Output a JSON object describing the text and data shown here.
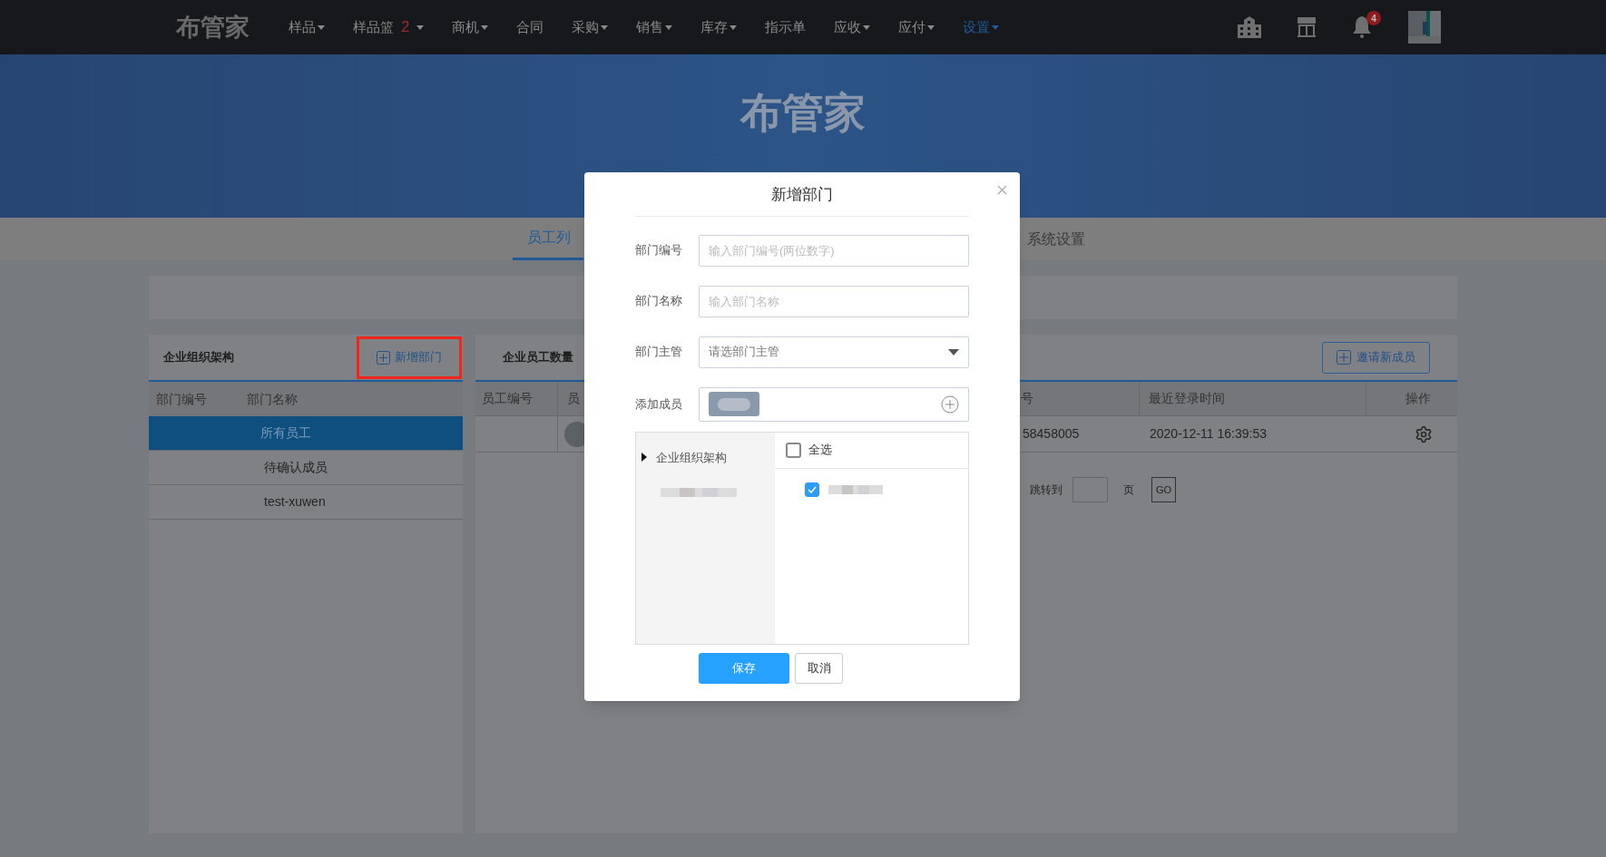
{
  "nav": {
    "logo": "布管家",
    "items": [
      {
        "label": "样品",
        "caret": true,
        "selected": false
      },
      {
        "label": "样品篮",
        "caret": true,
        "selected": false,
        "badge": "2"
      },
      {
        "label": "商机",
        "caret": true,
        "selected": false
      },
      {
        "label": "合同",
        "caret": false,
        "selected": false
      },
      {
        "label": "采购",
        "caret": true,
        "selected": false
      },
      {
        "label": "销售",
        "caret": true,
        "selected": false
      },
      {
        "label": "库存",
        "caret": true,
        "selected": false
      },
      {
        "label": "指示单",
        "caret": false,
        "selected": false
      },
      {
        "label": "应收",
        "caret": true,
        "selected": false
      },
      {
        "label": "应付",
        "caret": true,
        "selected": false
      },
      {
        "label": "设置",
        "caret": true,
        "selected": true
      }
    ],
    "notification_count": "4"
  },
  "banner": {
    "logo": "布管家"
  },
  "tabs": [
    {
      "label": "员工列",
      "selected": true
    },
    {
      "label": "系统设置",
      "selected": false
    }
  ],
  "departments": {
    "title": "企业组织架构",
    "add_button": "新增部门",
    "columns": [
      "部门编号",
      "部门名称"
    ],
    "rows": [
      {
        "name": "所有员工",
        "selected": true
      },
      {
        "name": "待确认成员",
        "selected": false
      },
      {
        "name": "test-xuwen",
        "selected": false
      }
    ]
  },
  "employees": {
    "title": "企业员工数量",
    "invite_button": "邀请新成员",
    "columns": [
      "员工编号",
      "员",
      "号",
      "最近登录时间",
      "操作"
    ],
    "rows": [
      {
        "phone": "58458005",
        "last_login": "2020-12-11 16:39:53"
      }
    ],
    "pager": {
      "jump_label": "跳转到",
      "page_label": "页",
      "go": "GO"
    }
  },
  "dialog": {
    "title": "新增部门",
    "fields": [
      {
        "kind": "text",
        "label": "部门编号",
        "placeholder": "输入部门编号(两位数字)"
      },
      {
        "kind": "text",
        "label": "部门名称",
        "placeholder": "输入部门名称"
      },
      {
        "kind": "select",
        "label": "部门主管",
        "placeholder": "请选部门主管"
      },
      {
        "kind": "members",
        "label": "添加成员"
      }
    ],
    "tree": {
      "root": "企业组织架构",
      "expanded": false
    },
    "select_all": {
      "label": "全选",
      "checked": false
    },
    "members": [
      {
        "checked": true
      }
    ],
    "buttons": [
      {
        "kind": "primary",
        "label": "保存"
      },
      {
        "kind": "secondary",
        "label": "取消"
      }
    ]
  }
}
